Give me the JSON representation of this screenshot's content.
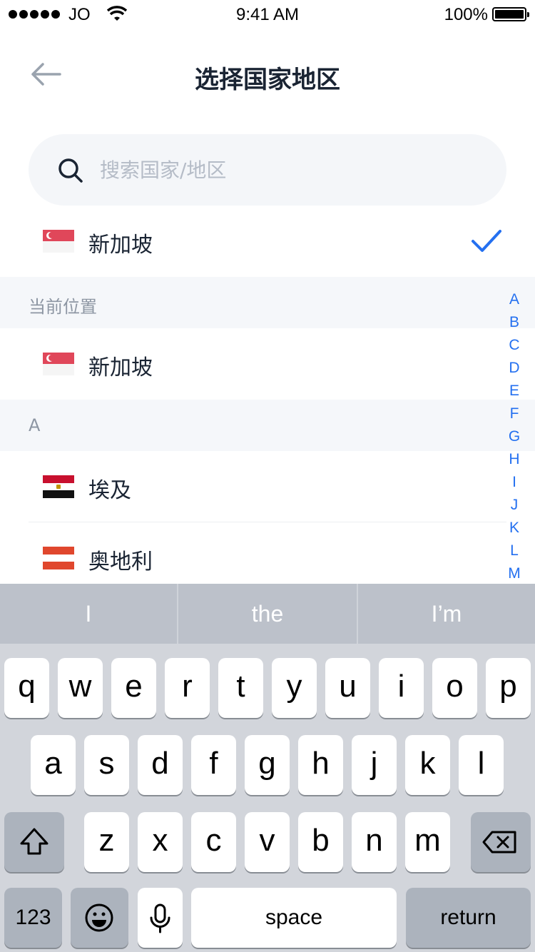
{
  "status_bar": {
    "carrier": "JO",
    "time": "9:41 AM",
    "battery": "100%"
  },
  "nav": {
    "title": "选择国家地区"
  },
  "search": {
    "placeholder": "搜索国家/地区"
  },
  "selected": {
    "name": "新加坡"
  },
  "sections": [
    {
      "title": "当前位置",
      "items": [
        {
          "name": "新加坡"
        }
      ]
    },
    {
      "title": "A",
      "items": [
        {
          "name": "埃及"
        },
        {
          "name": "奥地利"
        }
      ]
    }
  ],
  "index_letters": [
    "A",
    "B",
    "C",
    "D",
    "E",
    "F",
    "G",
    "H",
    "I",
    "J",
    "K",
    "L",
    "M"
  ],
  "keyboard": {
    "suggestions": [
      "I",
      "the",
      "I’m"
    ],
    "row1": [
      "q",
      "w",
      "e",
      "r",
      "t",
      "y",
      "u",
      "i",
      "o",
      "p"
    ],
    "row2": [
      "a",
      "s",
      "d",
      "f",
      "g",
      "h",
      "j",
      "k",
      "l"
    ],
    "row3": [
      "z",
      "x",
      "c",
      "v",
      "b",
      "n",
      "m"
    ],
    "numbers_label": "123",
    "space_label": "space",
    "return_label": "return"
  },
  "colors": {
    "accent": "#2470f0",
    "title_text": "#1a2433",
    "section_bg": "#f5f7fa",
    "search_bg": "#f4f6f9"
  }
}
